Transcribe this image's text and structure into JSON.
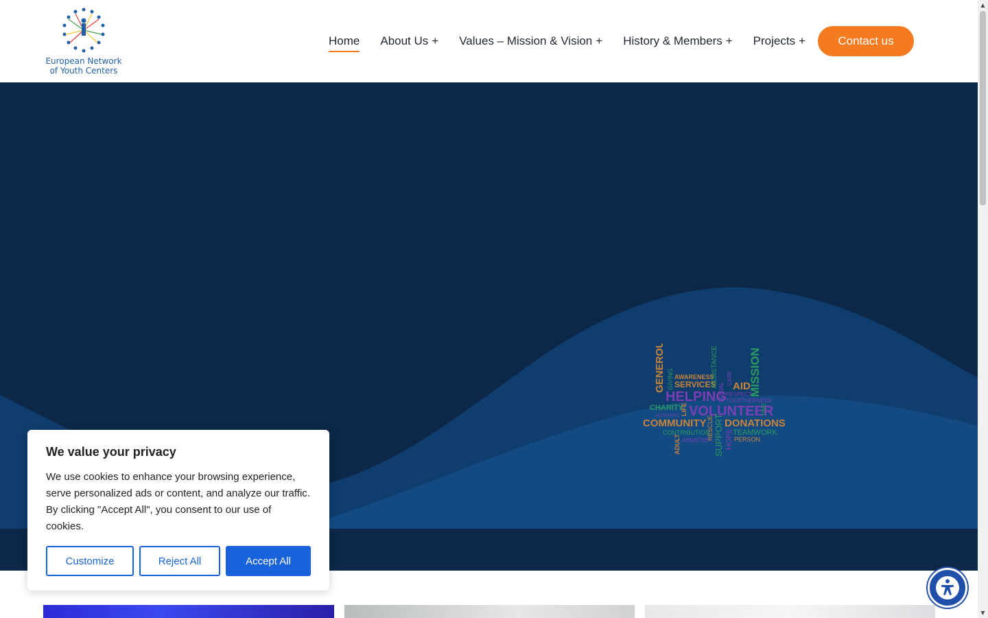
{
  "header": {
    "logo_line1": "European Network",
    "logo_line2": "of Youth Centers",
    "nav": [
      {
        "label": "Home",
        "plus": ""
      },
      {
        "label": "About Us",
        "plus": "+"
      },
      {
        "label": "Values – Mission & Vision",
        "plus": "+"
      },
      {
        "label": "History & Members",
        "plus": "+"
      },
      {
        "label": "Projects",
        "plus": "+"
      }
    ],
    "contact_label": "Contact us"
  },
  "hero": {
    "wordcloud": {
      "words": [
        "GENEROUS",
        "GIVING",
        "AWARENESS",
        "SERVICES",
        "ASSISTANCE",
        "AID",
        "MISSION",
        "HELPING",
        "SOCIAL",
        "CARE",
        "RESPECT",
        "TOGETHERNESS",
        "CHARITY",
        "ALTRUISTIC",
        "LIFE",
        "VOLUNTEER",
        "TIME",
        "COMMUNITY",
        "DONATIONS",
        "CONTRIBUTION",
        "RESCUE",
        "TEAMWORK",
        "ADULT",
        "ASSISTED",
        "SUPPORT",
        "HOPE",
        "PERSON"
      ]
    }
  },
  "cookie": {
    "title": "We value your privacy",
    "text": "We use cookies to enhance your browsing experience, serve personalized ads or content, and analyze our traffic. By clicking \"Accept All\", you consent to our use of cookies.",
    "customize_label": "Customize",
    "reject_label": "Reject All",
    "accept_label": "Accept All"
  },
  "colors": {
    "accent": "#f47b20",
    "hero_bg": "#0c2747",
    "wave": "#0f3d6e",
    "cookie_button": "#1863dc"
  },
  "icons": {
    "accessibility": "accessibility-icon",
    "scroll_up": "scroll-up-arrow-icon",
    "scroll_down": "scroll-down-arrow-icon"
  }
}
